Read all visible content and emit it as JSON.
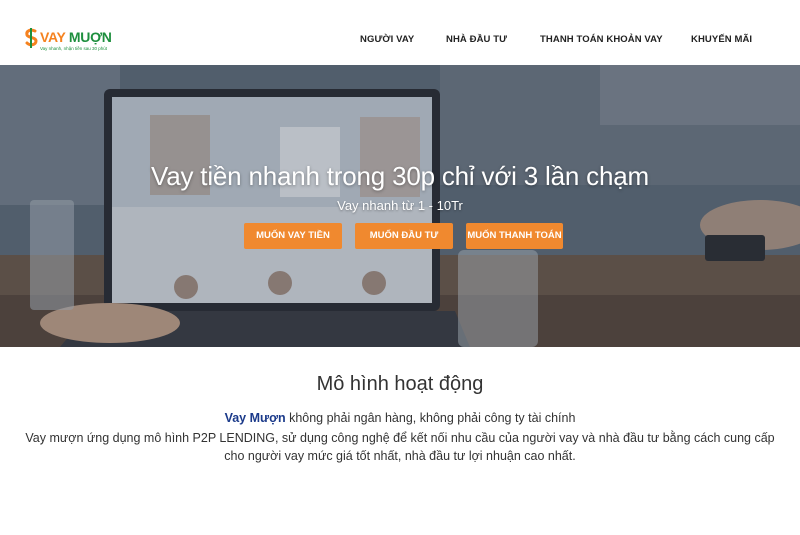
{
  "brand": {
    "name_part1": "VAY",
    "name_part2": "MUỢN",
    "tagline": "Vay nhanh, nhận tiền sau 30 phút"
  },
  "nav": {
    "items": [
      "NGƯỜI VAY",
      "NHÀ ĐẦU TƯ",
      "THANH TOÁN KHOẢN VAY",
      "KHUYẾN MÃI"
    ]
  },
  "hero": {
    "title": "Vay tiền nhanh trong 30p chỉ với 3 lần chạm",
    "subtitle": "Vay nhanh từ 1 - 10Tr",
    "buttons": [
      "MUỐN VAY TIỀN",
      "MUỐN ĐẦU TƯ",
      "MUỐN THANH TOÁN"
    ]
  },
  "section": {
    "title": "Mô hình hoạt động",
    "brand_name": "Vay Mượn",
    "line1_rest": " không phải ngân hàng, không phải công ty tài chính",
    "line2": "Vay mượn ứng dụng mô hình P2P LENDING, sử dụng công nghệ để kết nối nhu cầu của người vay và nhà đầu tư bằng cách cung cấp",
    "line3": "cho người vay mức giá tốt nhất, nhà đầu tư lợi nhuận cao nhất."
  },
  "colors": {
    "accent": "#f0892f",
    "brand_orange": "#f5821f",
    "brand_green": "#1e8f3e",
    "brand_link": "#1b3a8a"
  }
}
